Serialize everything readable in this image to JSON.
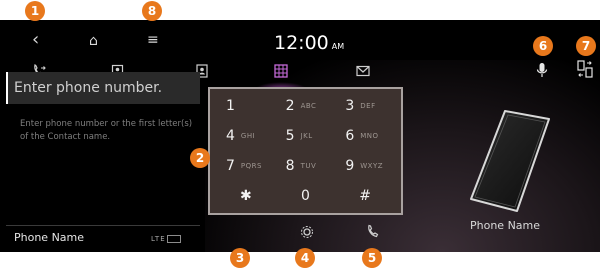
{
  "header": {
    "back_icon": "‹",
    "home_icon": "⌂",
    "menu_icon": "≡",
    "time": "12:00",
    "ampm": "AM"
  },
  "tabs": [
    {
      "name": "recent-calls-tab",
      "icon": "phone-arrow"
    },
    {
      "name": "favorites-tab",
      "icon": "star-contact"
    },
    {
      "name": "contacts-tab",
      "icon": "contact-book"
    },
    {
      "name": "keypad-tab",
      "icon": "keypad",
      "active": true
    },
    {
      "name": "messages-tab",
      "icon": "envelope"
    }
  ],
  "input": {
    "placeholder": "Enter phone number."
  },
  "hint": "Enter phone number or the first letter(s) of the Contact name.",
  "device": {
    "name": "Phone Name"
  },
  "bottom": {
    "phone_name": "Phone Name",
    "signal": "LTE"
  },
  "keypad": [
    {
      "digit": "1",
      "letters": ""
    },
    {
      "digit": "2",
      "letters": "ABC"
    },
    {
      "digit": "3",
      "letters": "DEF"
    },
    {
      "digit": "4",
      "letters": "GHI"
    },
    {
      "digit": "5",
      "letters": "JKL"
    },
    {
      "digit": "6",
      "letters": "MNO"
    },
    {
      "digit": "7",
      "letters": "PQRS"
    },
    {
      "digit": "8",
      "letters": "TUV"
    },
    {
      "digit": "9",
      "letters": "WXYZ"
    },
    {
      "digit": "✱",
      "letters": ""
    },
    {
      "digit": "0",
      "letters": "+"
    },
    {
      "digit": "#",
      "letters": ""
    }
  ],
  "badges": [
    "1",
    "2",
    "3",
    "4",
    "5",
    "6",
    "7",
    "8"
  ],
  "colors": {
    "badge": "#e8781c",
    "keypad_bg": "#3d322f",
    "active_tab": "#c46ad8"
  }
}
